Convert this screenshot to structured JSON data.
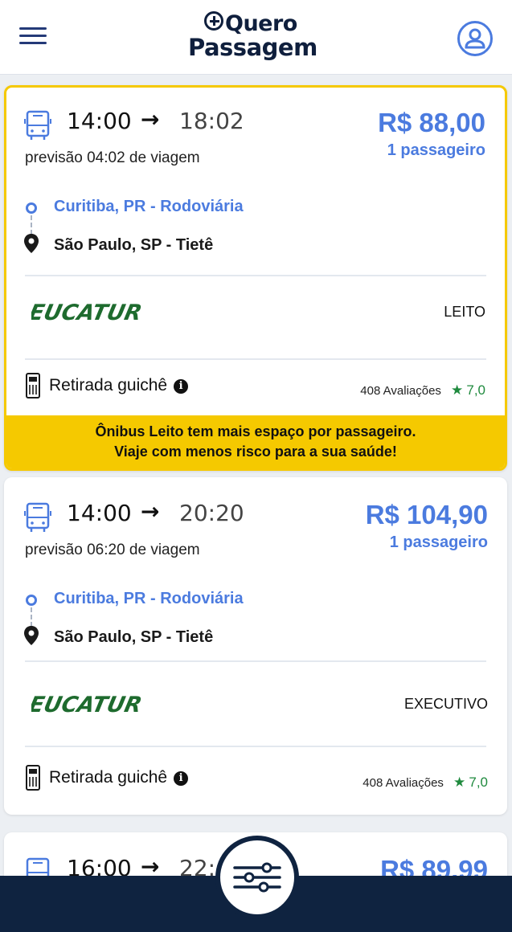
{
  "header": {
    "logo_line1": "Quero",
    "logo_line2": "Passagem"
  },
  "trips": [
    {
      "departure": "14:00",
      "arrival": "18:02",
      "duration": "previsão 04:02 de viagem",
      "price": "R$ 88,00",
      "passengers": "1 passageiro",
      "origin": "Curitiba, PR - Rodoviária",
      "destination": "São Paulo, SP - Tietê",
      "company": "EUCATUR",
      "class": "LEITO",
      "pickup": "Retirada guichê",
      "reviews": "408 Avaliações",
      "rating": "7,0",
      "notice_line1": "Ônibus Leito tem mais espaço por passageiro.",
      "notice_line2": "Viaje com menos risco para a sua saúde!"
    },
    {
      "departure": "14:00",
      "arrival": "20:20",
      "duration": "previsão 06:20 de viagem",
      "price": "R$ 104,90",
      "passengers": "1 passageiro",
      "origin": "Curitiba, PR - Rodoviária",
      "destination": "São Paulo, SP - Tietê",
      "company": "EUCATUR",
      "class": "EXECUTIVO",
      "pickup": "Retirada guichê",
      "reviews": "408 Avaliações",
      "rating": "7,0"
    },
    {
      "departure": "16:00",
      "arrival": "22:",
      "price": "R$ 89,99"
    }
  ],
  "colors": {
    "accent": "#4b7bdf",
    "highlight": "#f5c900",
    "navy": "#0f2340",
    "company_green": "#1e6b2e",
    "rating_green": "#1f8a3e"
  },
  "icons": {
    "menu": "hamburger-menu-icon",
    "user": "user-profile-icon",
    "bus": "bus-icon",
    "origin": "origin-circle-icon",
    "destination": "location-pin-icon",
    "ticket": "ticket-machine-icon",
    "info": "info-icon",
    "star": "star-icon",
    "filter": "filter-sliders-icon"
  }
}
